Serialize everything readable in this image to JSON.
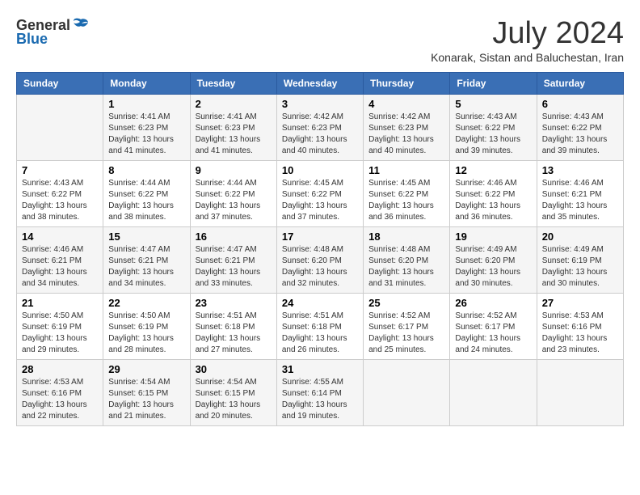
{
  "logo": {
    "general": "General",
    "blue": "Blue"
  },
  "title": "July 2024",
  "location": "Konarak, Sistan and Baluchestan, Iran",
  "days_of_week": [
    "Sunday",
    "Monday",
    "Tuesday",
    "Wednesday",
    "Thursday",
    "Friday",
    "Saturday"
  ],
  "weeks": [
    [
      {
        "day": "",
        "info": ""
      },
      {
        "day": "1",
        "info": "Sunrise: 4:41 AM\nSunset: 6:23 PM\nDaylight: 13 hours\nand 41 minutes."
      },
      {
        "day": "2",
        "info": "Sunrise: 4:41 AM\nSunset: 6:23 PM\nDaylight: 13 hours\nand 41 minutes."
      },
      {
        "day": "3",
        "info": "Sunrise: 4:42 AM\nSunset: 6:23 PM\nDaylight: 13 hours\nand 40 minutes."
      },
      {
        "day": "4",
        "info": "Sunrise: 4:42 AM\nSunset: 6:23 PM\nDaylight: 13 hours\nand 40 minutes."
      },
      {
        "day": "5",
        "info": "Sunrise: 4:43 AM\nSunset: 6:22 PM\nDaylight: 13 hours\nand 39 minutes."
      },
      {
        "day": "6",
        "info": "Sunrise: 4:43 AM\nSunset: 6:22 PM\nDaylight: 13 hours\nand 39 minutes."
      }
    ],
    [
      {
        "day": "7",
        "info": "Sunrise: 4:43 AM\nSunset: 6:22 PM\nDaylight: 13 hours\nand 38 minutes."
      },
      {
        "day": "8",
        "info": "Sunrise: 4:44 AM\nSunset: 6:22 PM\nDaylight: 13 hours\nand 38 minutes."
      },
      {
        "day": "9",
        "info": "Sunrise: 4:44 AM\nSunset: 6:22 PM\nDaylight: 13 hours\nand 37 minutes."
      },
      {
        "day": "10",
        "info": "Sunrise: 4:45 AM\nSunset: 6:22 PM\nDaylight: 13 hours\nand 37 minutes."
      },
      {
        "day": "11",
        "info": "Sunrise: 4:45 AM\nSunset: 6:22 PM\nDaylight: 13 hours\nand 36 minutes."
      },
      {
        "day": "12",
        "info": "Sunrise: 4:46 AM\nSunset: 6:22 PM\nDaylight: 13 hours\nand 36 minutes."
      },
      {
        "day": "13",
        "info": "Sunrise: 4:46 AM\nSunset: 6:21 PM\nDaylight: 13 hours\nand 35 minutes."
      }
    ],
    [
      {
        "day": "14",
        "info": "Sunrise: 4:46 AM\nSunset: 6:21 PM\nDaylight: 13 hours\nand 34 minutes."
      },
      {
        "day": "15",
        "info": "Sunrise: 4:47 AM\nSunset: 6:21 PM\nDaylight: 13 hours\nand 34 minutes."
      },
      {
        "day": "16",
        "info": "Sunrise: 4:47 AM\nSunset: 6:21 PM\nDaylight: 13 hours\nand 33 minutes."
      },
      {
        "day": "17",
        "info": "Sunrise: 4:48 AM\nSunset: 6:20 PM\nDaylight: 13 hours\nand 32 minutes."
      },
      {
        "day": "18",
        "info": "Sunrise: 4:48 AM\nSunset: 6:20 PM\nDaylight: 13 hours\nand 31 minutes."
      },
      {
        "day": "19",
        "info": "Sunrise: 4:49 AM\nSunset: 6:20 PM\nDaylight: 13 hours\nand 30 minutes."
      },
      {
        "day": "20",
        "info": "Sunrise: 4:49 AM\nSunset: 6:19 PM\nDaylight: 13 hours\nand 30 minutes."
      }
    ],
    [
      {
        "day": "21",
        "info": "Sunrise: 4:50 AM\nSunset: 6:19 PM\nDaylight: 13 hours\nand 29 minutes."
      },
      {
        "day": "22",
        "info": "Sunrise: 4:50 AM\nSunset: 6:19 PM\nDaylight: 13 hours\nand 28 minutes."
      },
      {
        "day": "23",
        "info": "Sunrise: 4:51 AM\nSunset: 6:18 PM\nDaylight: 13 hours\nand 27 minutes."
      },
      {
        "day": "24",
        "info": "Sunrise: 4:51 AM\nSunset: 6:18 PM\nDaylight: 13 hours\nand 26 minutes."
      },
      {
        "day": "25",
        "info": "Sunrise: 4:52 AM\nSunset: 6:17 PM\nDaylight: 13 hours\nand 25 minutes."
      },
      {
        "day": "26",
        "info": "Sunrise: 4:52 AM\nSunset: 6:17 PM\nDaylight: 13 hours\nand 24 minutes."
      },
      {
        "day": "27",
        "info": "Sunrise: 4:53 AM\nSunset: 6:16 PM\nDaylight: 13 hours\nand 23 minutes."
      }
    ],
    [
      {
        "day": "28",
        "info": "Sunrise: 4:53 AM\nSunset: 6:16 PM\nDaylight: 13 hours\nand 22 minutes."
      },
      {
        "day": "29",
        "info": "Sunrise: 4:54 AM\nSunset: 6:15 PM\nDaylight: 13 hours\nand 21 minutes."
      },
      {
        "day": "30",
        "info": "Sunrise: 4:54 AM\nSunset: 6:15 PM\nDaylight: 13 hours\nand 20 minutes."
      },
      {
        "day": "31",
        "info": "Sunrise: 4:55 AM\nSunset: 6:14 PM\nDaylight: 13 hours\nand 19 minutes."
      },
      {
        "day": "",
        "info": ""
      },
      {
        "day": "",
        "info": ""
      },
      {
        "day": "",
        "info": ""
      }
    ]
  ]
}
